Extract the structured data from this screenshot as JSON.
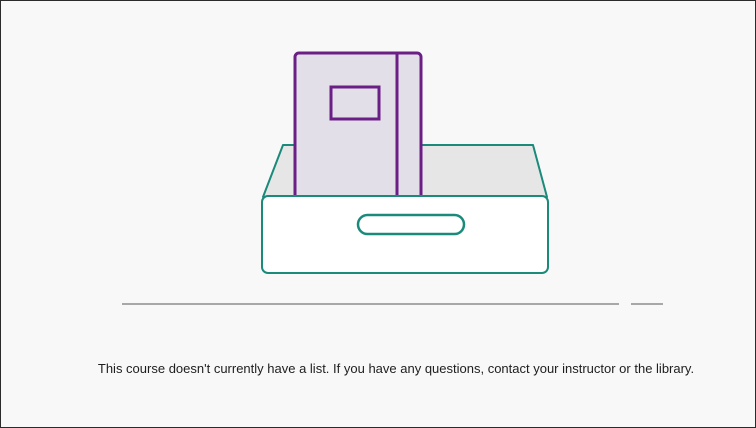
{
  "empty_state": {
    "message": "This course doesn't currently have a list. If you have any questions, contact your instructor or the library.",
    "illustration": {
      "icon": "book-in-tray-icon",
      "colors": {
        "book_fill": "#e3dfe8",
        "book_stroke": "#6b1f86",
        "tray_stroke": "#1a8a7a",
        "tray_fill": "#ffffff",
        "tray_inner": "#e6e6e6",
        "divider": "#a8a8a8"
      }
    }
  }
}
